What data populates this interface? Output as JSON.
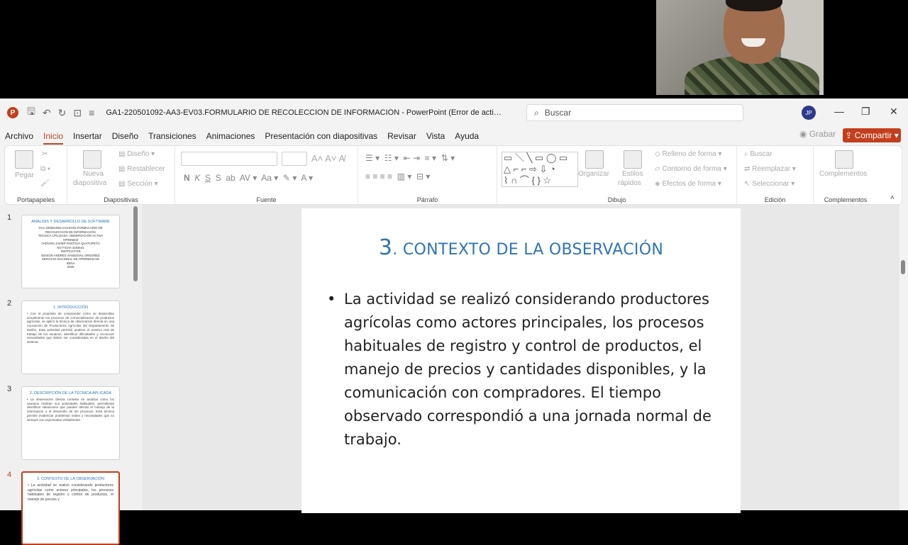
{
  "app": {
    "logo": "P",
    "doc_title": "GA1-220501092-AA3-EV03.FORMULARIO DE RECOLECCION DE INFORMACIÓN  -  PowerPoint (Error de activación de produc...",
    "search_placeholder": "Buscar",
    "avatar_initials": "JP"
  },
  "menu": {
    "tabs": [
      "Archivo",
      "Inicio",
      "Insertar",
      "Diseño",
      "Transiciones",
      "Animaciones",
      "Presentación con diapositivas",
      "Revisar",
      "Vista",
      "Ayuda"
    ],
    "grabar": "Grabar",
    "compartir": "Compartir"
  },
  "ribbon": {
    "portapapeles": {
      "label": "Portapapeles",
      "pegar": "Pegar"
    },
    "diapositivas": {
      "label": "Diapositivas",
      "nueva": "Nueva",
      "nueva2": "diapositiva",
      "diseno": "Diseño",
      "restablecer": "Restablecer",
      "seccion": "Sección"
    },
    "fuente": {
      "label": "Fuente"
    },
    "parrafo": {
      "label": "Párrafo"
    },
    "dibujo": {
      "label": "Dibujo",
      "organizar": "Organizar",
      "estilos": "Estilos",
      "rapidos": "rápidos",
      "relleno": "Relleno de forma",
      "contorno": "Contorno de forma",
      "efectos": "Efectos de forma"
    },
    "edicion": {
      "label": "Edición",
      "buscar": "Buscar",
      "reemplazar": "Reemplazar",
      "seleccionar": "Seleccionar"
    },
    "complementos": {
      "label": "Complementos",
      "btn": "Complementos"
    }
  },
  "thumbnails": [
    {
      "num": "1",
      "title": "ANÁLISIS Y DESARROLLO DE SOFTWARE",
      "lines": [
        "GA1-220501092-AA3-EV03.FORMULARIO DE",
        "RECOLECCION DE INFORMACIÓN",
        "TECNICA UTILIZADA: OBSERVACIÓN ACTIVA",
        "APRENDIZ",
        "JHOVANI JAVIER PANTOJA QUATUPETO",
        "NO FICHA 3183641",
        "INSTRUCTOR",
        "EDISON ANDRES SANDOVAL ORDOÑEZ",
        "SERVICIO NACIONAL DE APRENDIZAJE",
        "SENA",
        "2026"
      ]
    },
    {
      "num": "2",
      "title": "1. INTRODUCCIÓN",
      "body": "• Con el propósito de comprender cómo se desarrollan actualmente los procesos de comercialización de productos agrícolas, se aplicó la técnica de observación directa en una Asociación de Productores Agrícolas del Departamento de Nariño. Esta actividad permitió analizar el entorno real de trabajo de los usuarios, identificar dificultades y reconocer necesidades que deben ser consideradas en el diseño del sistema."
    },
    {
      "num": "3",
      "title": "2. DESCRIPCIÓN DE LA TÉCNICA APLICADA",
      "body": "• La observación directa consiste en analizar cómo los usuarios realizan sus actividades habituales, permitiendo identificar situaciones que pueden afectar el manejo de la información o el desarrollo de los procesos. Esta técnica permite evidenciar problemas reales y necesidades que no siempre son expresadas verbalmente."
    },
    {
      "num": "4",
      "title": "3. CONTEXTO DE LA OBSERVACIÓN",
      "body": "• La actividad se realizó considerando productores agrícolas como actores principales, los procesos habituales de registro y control de productos, el manejo de precios y"
    }
  ],
  "slide": {
    "title_num": "3",
    "title_text": ". CONTEXTO DE LA OBSERVACIÓN",
    "bullet": "•",
    "body": "La actividad se realizó considerando productores agrícolas como actores principales, los procesos habituales de registro y control de productos, el manejo de precios y cantidades disponibles, y la comunicación con compradores. El tiempo observado correspondió a una jornada normal de trabajo."
  }
}
